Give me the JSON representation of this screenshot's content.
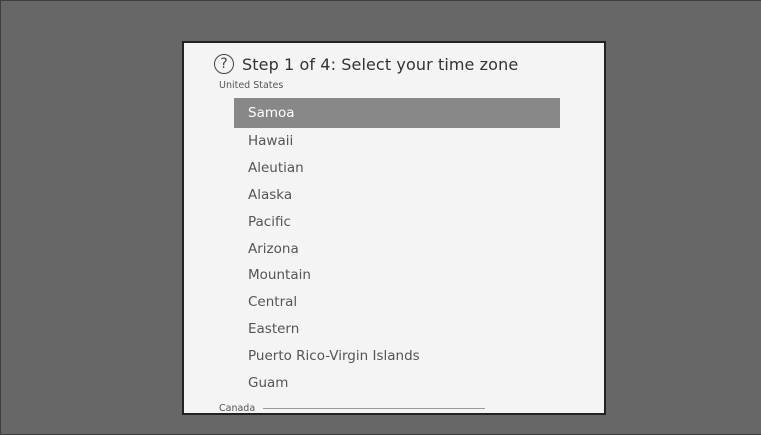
{
  "dialog": {
    "title": "Step 1 of 4: Select your time zone",
    "help_icon": "?"
  },
  "sections": {
    "us_label": "United States",
    "canada_label": "Canada"
  },
  "timezones": [
    {
      "label": "Samoa",
      "selected": true
    },
    {
      "label": "Hawaii"
    },
    {
      "label": "Aleutian"
    },
    {
      "label": "Alaska"
    },
    {
      "label": "Pacific"
    },
    {
      "label": "Arizona"
    },
    {
      "label": "Mountain"
    },
    {
      "label": "Central"
    },
    {
      "label": "Eastern"
    },
    {
      "label": "Puerto Rico-Virgin Islands"
    },
    {
      "label": "Guam"
    }
  ],
  "colors": {
    "background": "#676767",
    "dialog": "#f4f4f4",
    "selection": "#888888"
  }
}
